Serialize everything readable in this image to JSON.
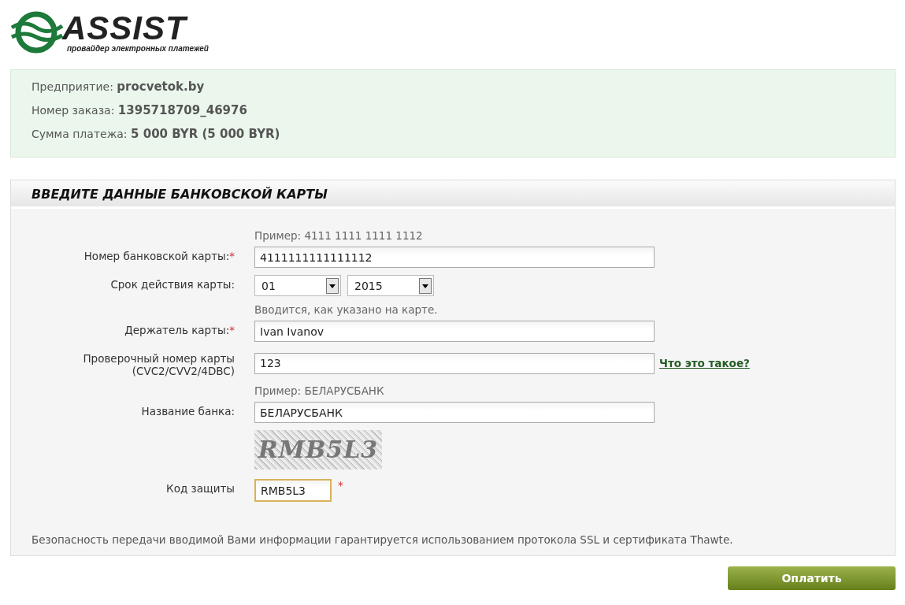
{
  "logo": {
    "name": "ASSIST",
    "tagline": "провайдер электронных платежей"
  },
  "order_info": [
    {
      "label": "Предприятие:",
      "value": "procvetok.by"
    },
    {
      "label": "Номер заказа:",
      "value": "1395718709_46976"
    },
    {
      "label": "Сумма платежа:",
      "value": "5 000 BYR (5 000 BYR)"
    }
  ],
  "card_form": {
    "title": "ВВЕДИТЕ ДАННЫЕ БАНКОВСКОЙ КАРТЫ",
    "rows": [
      {
        "kind": "text",
        "hint_above": "Пример: 4111 1111 1111 1112",
        "label": "Номер банковской карты:",
        "required_mark": "*",
        "value": "4111111111111112"
      },
      {
        "kind": "expiry",
        "label": "Срок действия карты:",
        "month": "01",
        "year": "2015",
        "hint_below": "Вводится, как указано на карте."
      },
      {
        "kind": "text",
        "label": "Держатель карты:",
        "required_mark": "*",
        "value": "Ivan Ivanov"
      },
      {
        "kind": "text",
        "label": "Проверочный номер карты (CVC2/CVV2/4DBC)",
        "value": "123",
        "link": "Что это такое?"
      },
      {
        "kind": "text",
        "hint_above": "Пример: БЕЛАРУСБАНК",
        "label": "Название банка:",
        "value": "БЕЛАРУСБАНК"
      },
      {
        "kind": "captcha",
        "captcha_text": "RMB5L3",
        "label": "Код защиты",
        "required_mark": "*",
        "value": "RMB5L3",
        "focused": true
      }
    ],
    "security_note": "Безопасность передачи вводимой Вами информации гарантируется использованием протокола SSL и сертификата Thawte."
  },
  "submit_button": "Оплатить"
}
